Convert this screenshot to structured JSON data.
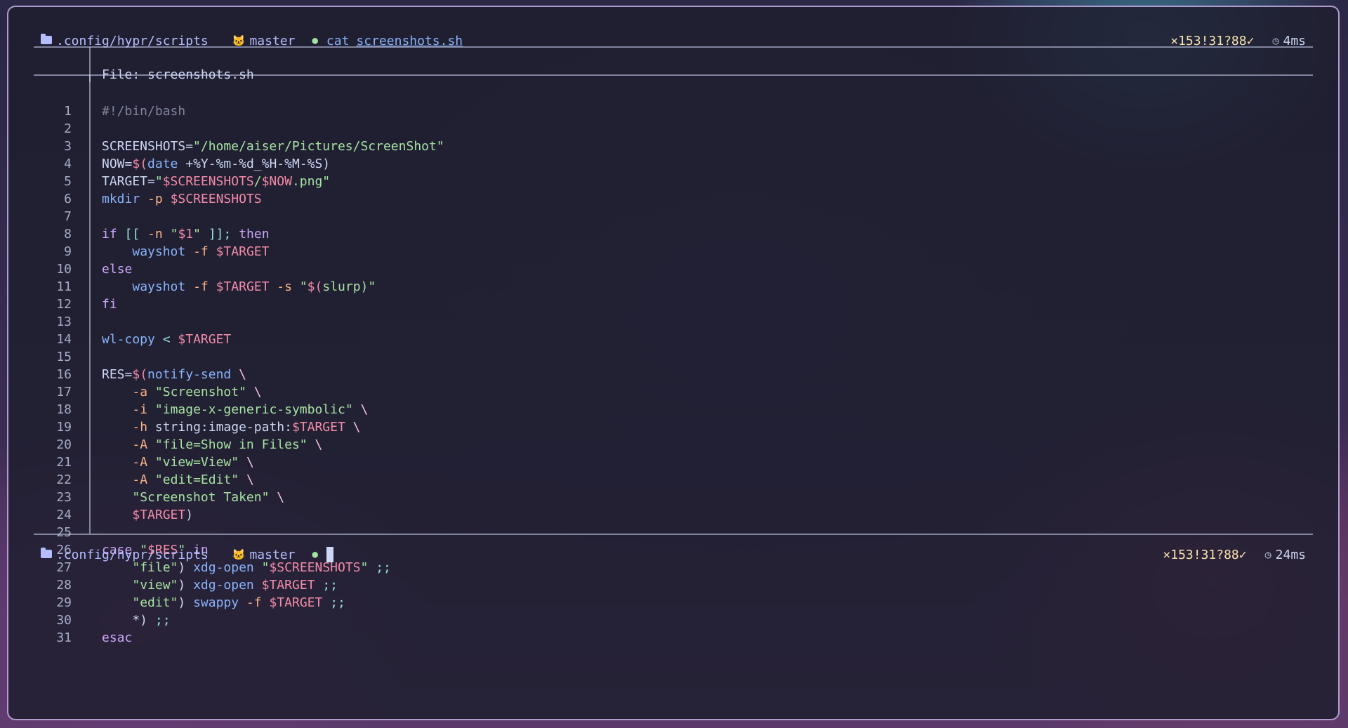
{
  "prompt_top": {
    "path": ".config/hypr/scripts",
    "branch": "master",
    "command": "cat",
    "argument": "screenshots.sh",
    "git_status": "×153!31?88✓",
    "duration": "4ms"
  },
  "prompt_bottom": {
    "path": ".config/hypr/scripts",
    "branch": "master",
    "git_status": "×153!31?88✓",
    "duration": "24ms"
  },
  "file_header": "File: screenshots.sh",
  "line_numbers": [
    "1",
    "2",
    "3",
    "4",
    "5",
    "6",
    "7",
    "8",
    "9",
    "10",
    "11",
    "12",
    "13",
    "14",
    "15",
    "16",
    "17",
    "18",
    "19",
    "20",
    "21",
    "22",
    "23",
    "24",
    "25",
    "26",
    "27",
    "28",
    "29",
    "30",
    "31"
  ],
  "code_lines": [
    "#!/bin/bash",
    "",
    "SCREENSHOTS=\"/home/aiser/Pictures/ScreenShot\"",
    "NOW=$(date +%Y-%m-%d_%H-%M-%S)",
    "TARGET=\"$SCREENSHOTS/$NOW.png\"",
    "mkdir -p $SCREENSHOTS",
    "",
    "if [[ -n \"$1\" ]]; then",
    "    wayshot -f $TARGET",
    "else",
    "    wayshot -f $TARGET -s \"$(slurp)\"",
    "fi",
    "",
    "wl-copy < $TARGET",
    "",
    "RES=$(notify-send \\",
    "    -a \"Screenshot\" \\",
    "    -i \"image-x-generic-symbolic\" \\",
    "    -h string:image-path:$TARGET \\",
    "    -A \"file=Show in Files\" \\",
    "    -A \"view=View\" \\",
    "    -A \"edit=Edit\" \\",
    "    \"Screenshot Taken\" \\",
    "    $TARGET)",
    "",
    "case \"$RES\" in",
    "    \"file\") xdg-open \"$SCREENSHOTS\" ;;",
    "    \"view\") xdg-open $TARGET ;;",
    "    \"edit\") swappy -f $TARGET ;;",
    "    *) ;;",
    "esac"
  ],
  "colors": {
    "background": "#1e1e2e",
    "text": "#cdd6f4",
    "string": "#a6e3a1",
    "variable": "#f38ba8",
    "keyword": "#cba6f7",
    "function": "#89b4fa",
    "git_status": "#f9e2af",
    "border": "#cdb4eb"
  },
  "icons": [
    "folder-icon",
    "github-icon",
    "clock-icon"
  ]
}
